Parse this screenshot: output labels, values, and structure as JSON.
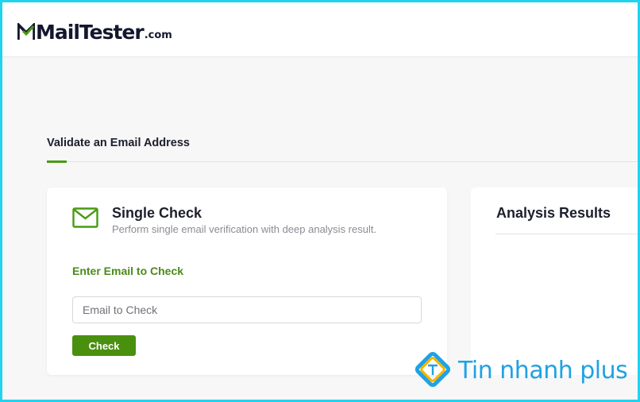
{
  "brand": {
    "logo_main": "MailTester",
    "logo_suffix": ".com",
    "logo_text_color": "#15172e",
    "logo_accent_color": "#4a9a13"
  },
  "tabs": {
    "active_label": "Validate an Email Address",
    "accent_color": "#4a9a13"
  },
  "single_check": {
    "icon": "mail-icon",
    "title": "Single Check",
    "subtitle": "Perform single email verification with deep analysis result.",
    "field_label": "Enter Email to Check",
    "input_placeholder": "Email to Check",
    "input_value": "",
    "button_label": "Check",
    "button_color": "#4a900f"
  },
  "analysis": {
    "title": "Analysis Results"
  },
  "watermark": {
    "text": "Tin nhanh plus",
    "color": "#1fa2e3"
  }
}
